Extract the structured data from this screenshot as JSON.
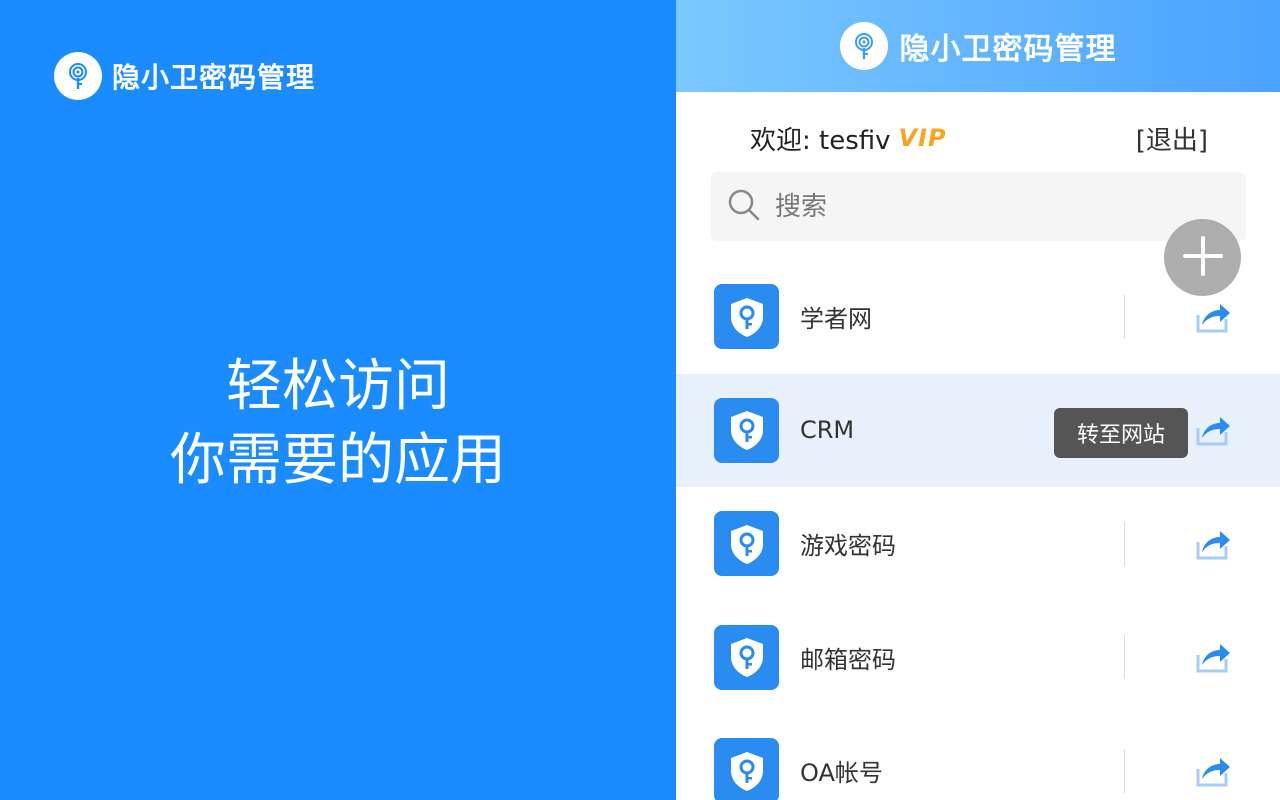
{
  "promo": {
    "brand_name": "隐小卫密码管理",
    "logo_icon": "fingerprint-key-icon",
    "slogan_line1": "轻松访问",
    "slogan_line2": "你需要的应用",
    "background_color": "#1a8cff"
  },
  "app": {
    "header": {
      "brand_name": "隐小卫密码管理",
      "logo_icon": "fingerprint-key-icon"
    },
    "welcome": {
      "label": "欢迎: tesfiv",
      "vip_badge": "VIP",
      "logout": "[退出]"
    },
    "search": {
      "placeholder": "搜索",
      "icon": "search-icon"
    },
    "add_button_icon": "plus-icon",
    "items": [
      {
        "name": "学者网",
        "icon": "shield-key-icon",
        "action_icon": "share-arrow-icon"
      },
      {
        "name": "CRM",
        "icon": "shield-key-icon",
        "action_icon": "share-arrow-icon",
        "active": true
      },
      {
        "name": "游戏密码",
        "icon": "shield-key-icon",
        "action_icon": "share-arrow-icon"
      },
      {
        "name": "邮箱密码",
        "icon": "shield-key-icon",
        "action_icon": "share-arrow-icon"
      },
      {
        "name": "OA帐号",
        "icon": "shield-key-icon",
        "action_icon": "share-arrow-icon"
      }
    ],
    "tooltip": "转至网站",
    "accent_color": "#2a8cf0"
  }
}
